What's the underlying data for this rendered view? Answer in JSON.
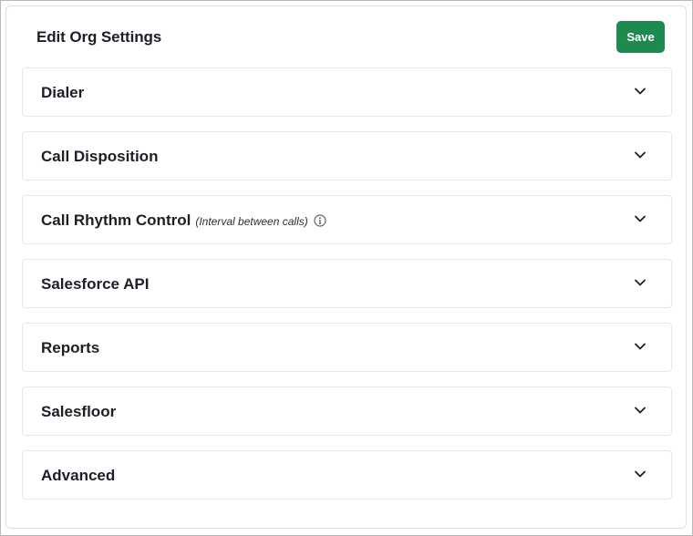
{
  "header": {
    "title": "Edit Org Settings",
    "save_label": "Save"
  },
  "sections": [
    {
      "title": "Dialer"
    },
    {
      "title": "Call Disposition"
    },
    {
      "title": "Call Rhythm Control",
      "subtitle": "(Interval between calls)",
      "icon": "info-icon"
    },
    {
      "title": "Salesforce API"
    },
    {
      "title": "Reports"
    },
    {
      "title": "Salesfloor"
    },
    {
      "title": "Advanced"
    }
  ],
  "icons": {
    "expand": "chevron-down-icon",
    "info": "info-icon"
  },
  "colors": {
    "accent": "#1e8a50",
    "text": "#1c1f26",
    "border": "#e4e6ea"
  }
}
